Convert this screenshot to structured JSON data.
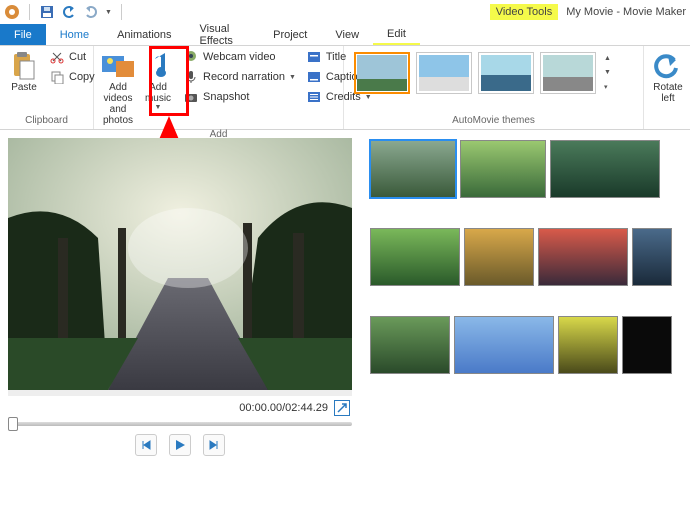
{
  "title": "My Movie - Movie Maker",
  "videoTools": {
    "group": "Video Tools",
    "tab": "Edit"
  },
  "tabs": {
    "file": "File",
    "home": "Home",
    "animations": "Animations",
    "visualEffects": "Visual Effects",
    "project": "Project",
    "view": "View"
  },
  "clipboard": {
    "paste": "Paste",
    "cut": "Cut",
    "copy": "Copy",
    "label": "Clipboard"
  },
  "add": {
    "addVideos": "Add videos and photos",
    "addMusic": "Add music",
    "webcam": "Webcam video",
    "record": "Record narration",
    "snapshot": "Snapshot",
    "title": "Title",
    "caption": "Caption",
    "credits": "Credits",
    "label": "Add"
  },
  "themes": {
    "label": "AutoMovie themes"
  },
  "rotate": {
    "left": "Rotate left"
  },
  "preview": {
    "time": "00:00.00/02:44.29"
  }
}
